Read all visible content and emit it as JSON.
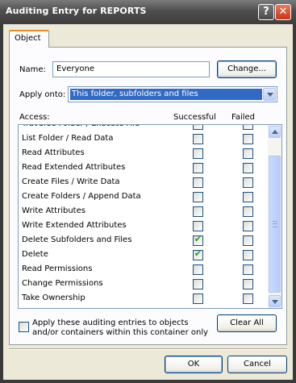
{
  "window": {
    "title": "Auditing Entry for REPORTS",
    "help_label": "?",
    "close_label": "✕"
  },
  "tabs": [
    {
      "label": "Object",
      "selected": true
    }
  ],
  "name": {
    "label": "Name:",
    "value": "Everyone",
    "change_button": "Change..."
  },
  "apply_onto": {
    "label": "Apply onto:",
    "value": "This folder, subfolders and files"
  },
  "access": {
    "header": "Access:",
    "col_successful": "Successful",
    "col_failed": "Failed",
    "rows": [
      {
        "label": "Traverse Folder / Execute File",
        "successful": false,
        "failed": false
      },
      {
        "label": "List Folder / Read Data",
        "successful": false,
        "failed": false
      },
      {
        "label": "Read Attributes",
        "successful": false,
        "failed": false
      },
      {
        "label": "Read Extended Attributes",
        "successful": false,
        "failed": false
      },
      {
        "label": "Create Files / Write Data",
        "successful": false,
        "failed": false
      },
      {
        "label": "Create Folders / Append Data",
        "successful": false,
        "failed": false
      },
      {
        "label": "Write Attributes",
        "successful": false,
        "failed": false
      },
      {
        "label": "Write Extended Attributes",
        "successful": false,
        "failed": false
      },
      {
        "label": "Delete Subfolders and Files",
        "successful": true,
        "failed": false
      },
      {
        "label": "Delete",
        "successful": true,
        "failed": false
      },
      {
        "label": "Read Permissions",
        "successful": false,
        "failed": false
      },
      {
        "label": "Change Permissions",
        "successful": false,
        "failed": false
      },
      {
        "label": "Take Ownership",
        "successful": false,
        "failed": false
      }
    ]
  },
  "apply_children": {
    "line1": "Apply these auditing entries to objects",
    "line2": "and/or containers within this container only",
    "checked": false
  },
  "clear_all_label": "Clear All",
  "ok_label": "OK",
  "cancel_label": "Cancel"
}
